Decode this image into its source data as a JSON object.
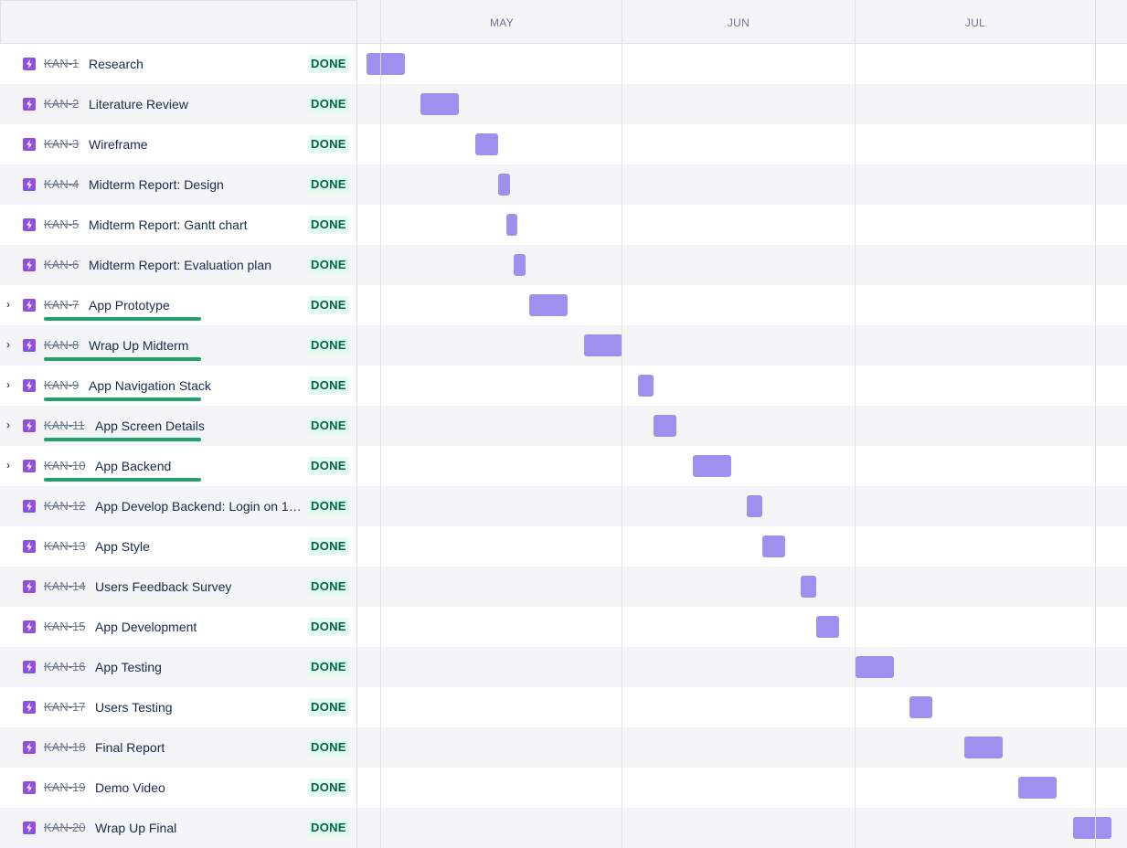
{
  "timeline": {
    "months": [
      "MAY",
      "JUN",
      "JUL"
    ],
    "bar_color": "#9f8fef",
    "status_color": "#006644",
    "issue_icon": "subtask-lightning-icon"
  },
  "issues": [
    {
      "key": "KAN-1",
      "summary": "Research",
      "status": "DONE",
      "expandable": false
    },
    {
      "key": "KAN-2",
      "summary": "Literature Review",
      "status": "DONE",
      "expandable": false
    },
    {
      "key": "KAN-3",
      "summary": "Wireframe",
      "status": "DONE",
      "expandable": false
    },
    {
      "key": "KAN-4",
      "summary": "Midterm Report: Design",
      "status": "DONE",
      "expandable": false
    },
    {
      "key": "KAN-5",
      "summary": "Midterm Report: Gantt chart",
      "status": "DONE",
      "expandable": false
    },
    {
      "key": "KAN-6",
      "summary": "Midterm Report: Evaluation plan",
      "status": "DONE",
      "expandable": false
    },
    {
      "key": "KAN-7",
      "summary": "App Prototype",
      "status": "DONE",
      "expandable": true,
      "progress": 1.0
    },
    {
      "key": "KAN-8",
      "summary": "Wrap Up Midterm",
      "status": "DONE",
      "expandable": true,
      "progress": 1.0
    },
    {
      "key": "KAN-9",
      "summary": "App Navigation Stack",
      "status": "DONE",
      "expandable": true,
      "progress": 1.0
    },
    {
      "key": "KAN-11",
      "summary": "App Screen Details",
      "status": "DONE",
      "expandable": true,
      "progress": 1.0
    },
    {
      "key": "KAN-10",
      "summary": "App Backend",
      "status": "DONE",
      "expandable": true,
      "progress": 1.0
    },
    {
      "key": "KAN-12",
      "summary": "App Develop Backend: Login on 1 d...",
      "status": "DONE",
      "expandable": false
    },
    {
      "key": "KAN-13",
      "summary": "App Style",
      "status": "DONE",
      "expandable": false
    },
    {
      "key": "KAN-14",
      "summary": "Users Feedback Survey",
      "status": "DONE",
      "expandable": false
    },
    {
      "key": "KAN-15",
      "summary": "App Development",
      "status": "DONE",
      "expandable": false
    },
    {
      "key": "KAN-16",
      "summary": "App Testing",
      "status": "DONE",
      "expandable": false
    },
    {
      "key": "KAN-17",
      "summary": "Users Testing",
      "status": "DONE",
      "expandable": false
    },
    {
      "key": "KAN-18",
      "summary": "Final Report",
      "status": "DONE",
      "expandable": false
    },
    {
      "key": "KAN-19",
      "summary": "Demo Video",
      "status": "DONE",
      "expandable": false
    },
    {
      "key": "KAN-20",
      "summary": "Wrap Up Final",
      "status": "DONE",
      "expandable": false
    }
  ]
}
